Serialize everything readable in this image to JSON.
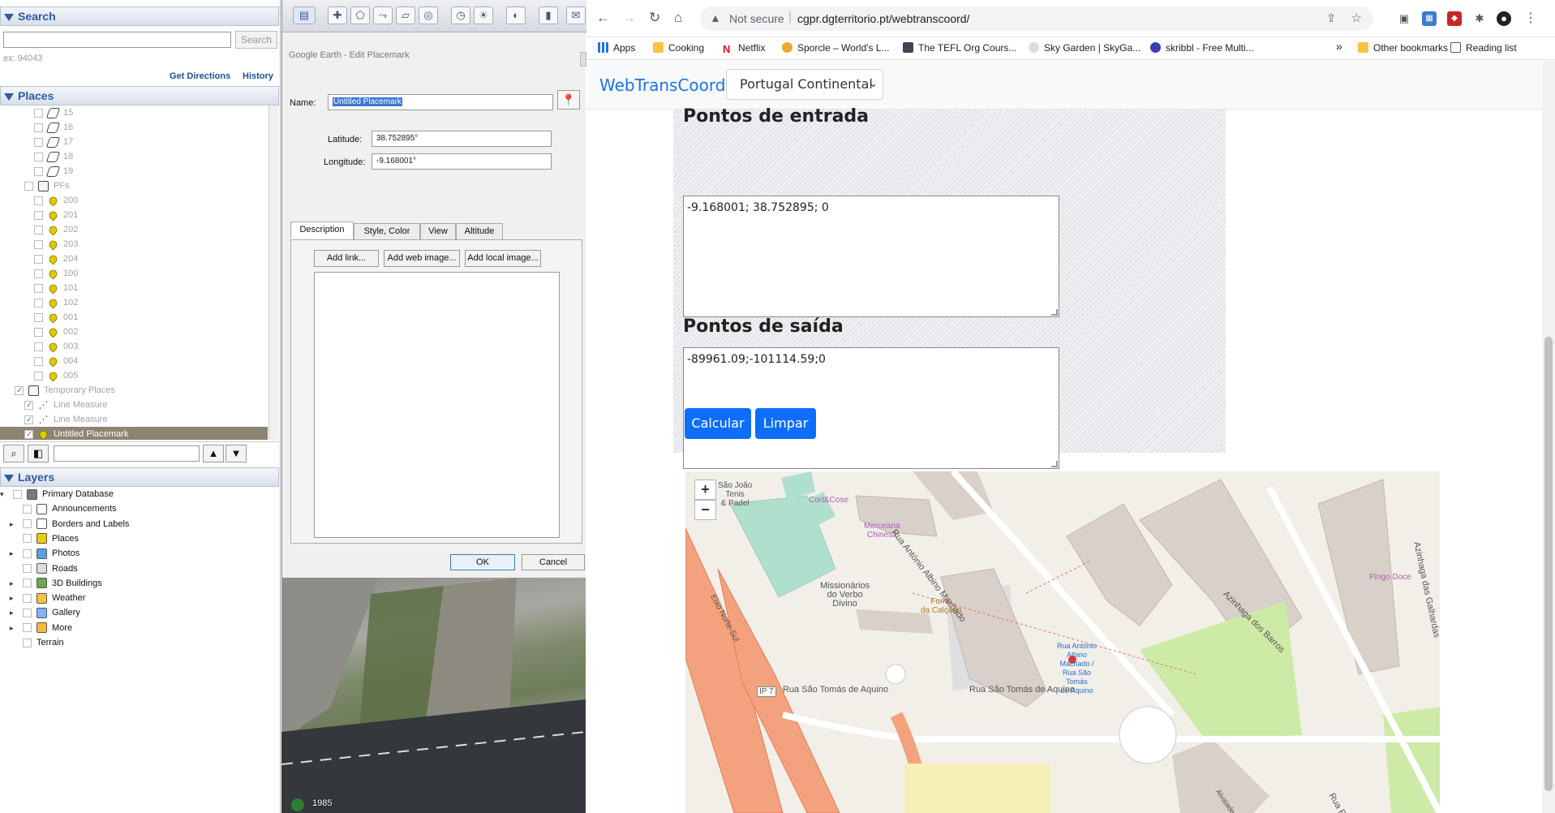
{
  "ge_left": {
    "search_header": "Search",
    "search_button": "Search",
    "search_hint": "ex: 94043",
    "get_directions": "Get Directions",
    "history": "History",
    "places_header": "Places",
    "places_items": [
      {
        "label": "15",
        "icon": "polygon-icon",
        "grey": true,
        "indent": 2
      },
      {
        "label": "16",
        "icon": "polygon-icon",
        "grey": true,
        "indent": 2
      },
      {
        "label": "17",
        "icon": "polygon-icon",
        "grey": true,
        "indent": 2
      },
      {
        "label": "18",
        "icon": "polygon-icon",
        "grey": true,
        "indent": 2
      },
      {
        "label": "19",
        "icon": "polygon-icon",
        "grey": true,
        "indent": 2
      },
      {
        "label": "PFs",
        "icon": "folder-icon",
        "grey": true,
        "indent": 1
      },
      {
        "label": "200",
        "icon": "placemark-pin-icon",
        "grey": true,
        "indent": 2
      },
      {
        "label": "201",
        "icon": "placemark-pin-icon",
        "grey": true,
        "indent": 2
      },
      {
        "label": "202",
        "icon": "placemark-pin-icon",
        "grey": true,
        "indent": 2
      },
      {
        "label": "203",
        "icon": "placemark-pin-icon",
        "grey": true,
        "indent": 2
      },
      {
        "label": "204",
        "icon": "placemark-pin-icon",
        "grey": true,
        "indent": 2
      },
      {
        "label": "100",
        "icon": "placemark-pin-icon",
        "grey": true,
        "indent": 2
      },
      {
        "label": "101",
        "icon": "placemark-pin-icon",
        "grey": true,
        "indent": 2
      },
      {
        "label": "102",
        "icon": "placemark-pin-icon",
        "grey": true,
        "indent": 2
      },
      {
        "label": "001",
        "icon": "placemark-pin-icon",
        "grey": true,
        "indent": 2
      },
      {
        "label": "002",
        "icon": "placemark-pin-icon",
        "grey": true,
        "indent": 2
      },
      {
        "label": "003",
        "icon": "placemark-pin-icon",
        "grey": true,
        "indent": 2
      },
      {
        "label": "004",
        "icon": "placemark-pin-icon",
        "grey": true,
        "indent": 2
      },
      {
        "label": "005",
        "icon": "placemark-pin-icon",
        "grey": true,
        "indent": 2
      },
      {
        "label": "Temporary Places",
        "icon": "folder-icon",
        "grey": true,
        "indent": 0,
        "checked": true
      },
      {
        "label": "Line Measure",
        "icon": "line-measure-icon",
        "grey": true,
        "indent": 1,
        "checked": true
      },
      {
        "label": "Line Measure",
        "icon": "line-measure-icon",
        "grey": true,
        "indent": 1,
        "checked": true
      },
      {
        "label": "Untitled Placemark",
        "icon": "placemark-pin-icon",
        "grey": false,
        "indent": 1,
        "checked": true,
        "selected": true
      }
    ],
    "layers_header": "Layers",
    "layers_items": [
      {
        "label": "Primary Database",
        "icon": "database-icon",
        "root": true
      },
      {
        "label": "Announcements",
        "icon": "envelope-icon"
      },
      {
        "label": "Borders and Labels",
        "icon": "flag-icon",
        "expandable": true
      },
      {
        "label": "Places",
        "icon": "places-icon"
      },
      {
        "label": "Photos",
        "icon": "photos-icon",
        "expandable": true
      },
      {
        "label": "Roads",
        "icon": "roads-icon"
      },
      {
        "label": "3D Buildings",
        "icon": "buildings-icon",
        "expandable": true
      },
      {
        "label": "Weather",
        "icon": "weather-icon",
        "expandable": true
      },
      {
        "label": "Gallery",
        "icon": "gallery-icon",
        "expandable": true
      },
      {
        "label": "More",
        "icon": "more-icon",
        "expandable": true
      },
      {
        "label": "Terrain",
        "icon": "",
        "plain": true
      }
    ]
  },
  "ge_dialog": {
    "title": "Google Earth - Edit Placemark",
    "name_label": "Name:",
    "name_value": "Untitled Placemark",
    "latitude_label": "Latitude:",
    "latitude_value": "38.752895°",
    "longitude_label": "Longitude:",
    "longitude_value": "-9.168001°",
    "tabs": [
      "Description",
      "Style, Color",
      "View",
      "Altitude"
    ],
    "add_link": "Add link...",
    "add_web_image": "Add web image...",
    "add_local_image": "Add local image...",
    "ok": "OK",
    "cancel": "Cancel",
    "imagery_year": "1985"
  },
  "chrome": {
    "not_secure": "Not secure",
    "url": "cgpr.dgterritorio.pt/webtranscoord/",
    "bookmarks": [
      "Apps",
      "Cooking",
      "Netflix",
      "Sporcle – World's L...",
      "The TEFL Org Cours...",
      "Sky Garden | SkyGa...",
      "skribbl - Free Multi..."
    ],
    "overflow": "»",
    "other_bookmarks": "Other bookmarks",
    "reading_list": "Reading list"
  },
  "page": {
    "brand": "WebTransCoord",
    "region_selected": "Portugal Continental",
    "input_heading": "Pontos de entrada",
    "input_value": "-9.168001; 38.752895; 0",
    "output_heading": "Pontos de saída",
    "output_value": "-89961.09;-101114.59;0",
    "calc_button": "Calcular",
    "clear_button": "Limpar"
  },
  "map": {
    "zoom_in": "+",
    "zoom_out": "−",
    "labels": {
      "sao_joao": "São João\nTenis\n& Padel",
      "cort_cose": "Cort&Cose",
      "mercearia": "Mercearia\nChinesa",
      "missionarios": "Missionários\ndo Verbo\nDivino",
      "forno": "Forno\nda Calçada",
      "rua_albino": "Rua António Albino Machado",
      "eixo": "Eixo Norte-Sul",
      "ip7": "IP 7",
      "sao_tomas_1": "Rua São Tomás de Aquino",
      "sao_tomas_2": "Rua São Tomás de Aquino",
      "bus_stop": "Rua António\nAlbino\nMachado /\nRua São\nTomás\nde Aquino",
      "azinhaga_barros": "Azinhaga dos Barros",
      "azinhaga_galhardas": "Azinhaga das Galhardas",
      "pingo_doce": "Pingo Doce",
      "alvalade": "Alvalade",
      "rua_pa": "Rua Pa"
    }
  }
}
